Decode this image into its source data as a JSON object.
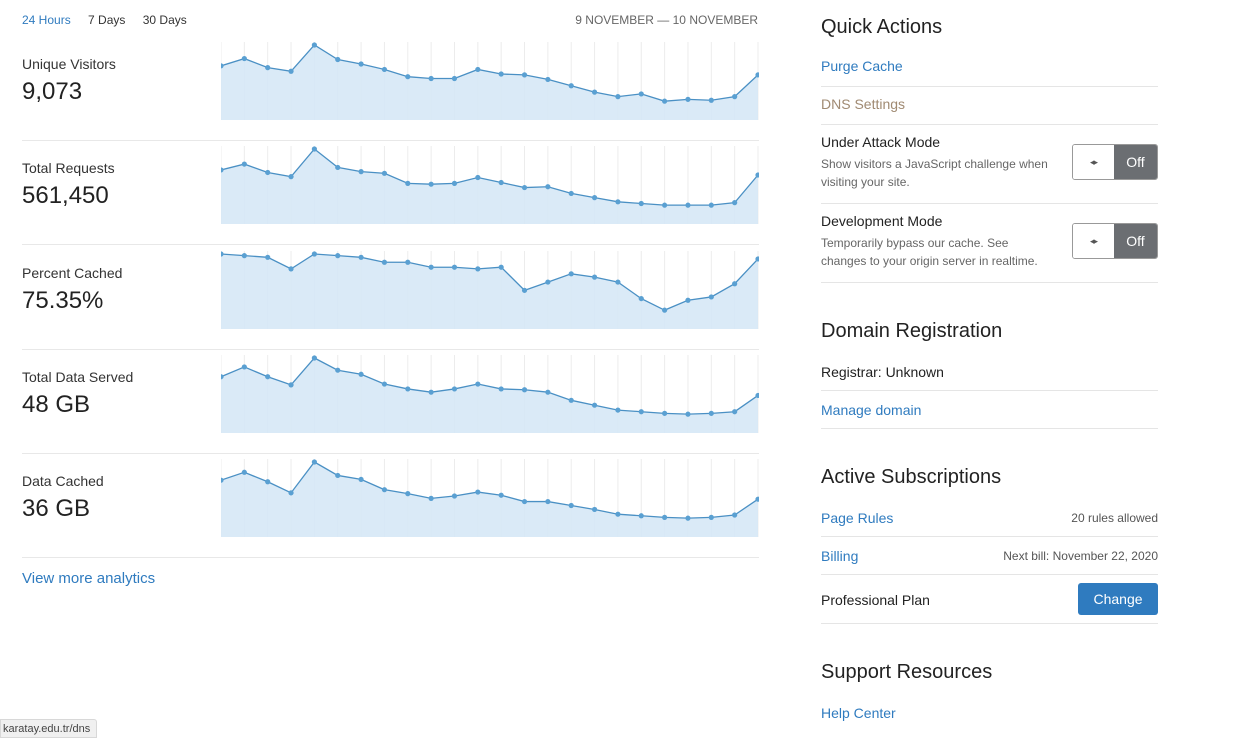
{
  "range": {
    "tabs": [
      "24 Hours",
      "7 Days",
      "30 Days"
    ],
    "active_index": 0,
    "date_range": "9 NOVEMBER — 10 NOVEMBER"
  },
  "metrics": [
    {
      "label": "Unique Visitors",
      "value": "9,073"
    },
    {
      "label": "Total Requests",
      "value": "561,450"
    },
    {
      "label": "Percent Cached",
      "value": "75.35%"
    },
    {
      "label": "Total Data Served",
      "value": "48 GB"
    },
    {
      "label": "Data Cached",
      "value": "36 GB"
    }
  ],
  "chart_data": [
    {
      "type": "area",
      "series": [
        {
          "values": [
            75,
            67,
            77,
            81,
            52,
            68,
            73,
            79,
            87,
            89,
            89,
            79,
            84,
            85,
            90,
            97,
            104,
            109,
            106,
            114,
            112,
            113,
            109,
            85
          ]
        }
      ]
    },
    {
      "type": "area",
      "series": [
        {
          "values": [
            182,
            175,
            185,
            190,
            157,
            179,
            184,
            186,
            198,
            199,
            198,
            191,
            197,
            203,
            202,
            210,
            215,
            220,
            222,
            224,
            224,
            224,
            221,
            188
          ]
        }
      ]
    },
    {
      "type": "area",
      "series": [
        {
          "values": [
            262,
            263,
            264,
            271,
            262,
            263,
            264,
            267,
            267,
            270,
            270,
            271,
            270,
            284,
            279,
            274,
            276,
            279,
            289,
            296,
            290,
            288,
            280,
            265
          ]
        }
      ]
    },
    {
      "type": "area",
      "series": [
        {
          "values": [
            389,
            377,
            389,
            399,
            366,
            381,
            386,
            398,
            404,
            408,
            404,
            398,
            404,
            405,
            408,
            418,
            424,
            430,
            432,
            434,
            435,
            434,
            432,
            412
          ]
        }
      ]
    },
    {
      "type": "area",
      "series": [
        {
          "values": [
            493,
            483,
            495,
            509,
            470,
            487,
            492,
            505,
            510,
            516,
            513,
            508,
            512,
            520,
            520,
            525,
            530,
            536,
            538,
            540,
            541,
            540,
            537,
            517
          ]
        }
      ]
    }
  ],
  "view_more": "View more analytics",
  "status_url": "karatay.edu.tr/dns",
  "quick_actions": {
    "title": "Quick Actions",
    "purge_cache": "Purge Cache",
    "dns_settings": "DNS Settings",
    "under_attack": {
      "title": "Under Attack Mode",
      "desc": "Show visitors a JavaScript challenge when visiting your site.",
      "state": "Off",
      "knob": "◂▸"
    },
    "dev_mode": {
      "title": "Development Mode",
      "desc": "Temporarily bypass our cache. See changes to your origin server in realtime.",
      "state": "Off",
      "knob": "◂▸"
    }
  },
  "domain_registration": {
    "title": "Domain Registration",
    "registrar": "Registrar: Unknown",
    "manage": "Manage domain"
  },
  "subscriptions": {
    "title": "Active Subscriptions",
    "page_rules": "Page Rules",
    "page_rules_note": "20 rules allowed",
    "billing": "Billing",
    "billing_note": "Next bill: November 22, 2020",
    "plan": "Professional Plan",
    "change": "Change"
  },
  "support": {
    "title": "Support Resources",
    "help_center": "Help Center"
  },
  "colors": {
    "accent": "#2f7bbf",
    "chart_line": "#4a90c4",
    "chart_fill": "#d6e8f6",
    "toggle_off": "#6b6e72"
  }
}
